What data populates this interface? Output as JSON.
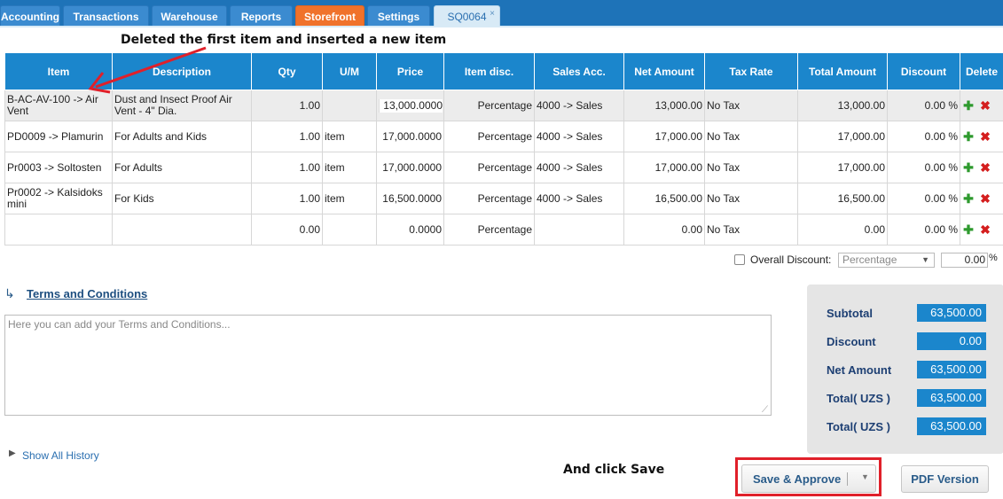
{
  "nav": {
    "tabs": [
      {
        "label": "Accounting"
      },
      {
        "label": "Transactions"
      },
      {
        "label": "Warehouse"
      },
      {
        "label": "Reports"
      },
      {
        "label": "Storefront"
      },
      {
        "label": "Settings"
      },
      {
        "label": "SQ0064"
      }
    ],
    "close_glyph": "×"
  },
  "annotations": {
    "top_note": "Deleted the first item and inserted a new item",
    "bottom_note": "And click Save",
    "colors": {
      "arrow": "#e0202a",
      "highlight_box": "#e0202a"
    }
  },
  "table": {
    "headers": [
      "Item",
      "Description",
      "Qty",
      "U/M",
      "Price",
      "Item disc.",
      "Sales Acc.",
      "Net Amount",
      "Tax Rate",
      "Total Amount",
      "Discount",
      "Delete"
    ],
    "rows": [
      {
        "item": "B-AC-AV-100 -> Air Vent",
        "description": "Dust and Insect Proof Air Vent - 4\" Dia.",
        "qty": "1.00",
        "um": "",
        "price": "13,000.0000",
        "item_disc": "Percentage",
        "sales_acc": "4000 -> Sales",
        "net_amount": "13,000.00",
        "tax_rate": "No Tax",
        "total_amount": "13,000.00",
        "discount": "0.00 %"
      },
      {
        "item": "PD0009 -> Plamurin",
        "description": "For Adults and Kids",
        "qty": "1.00",
        "um": "item",
        "price": "17,000.0000",
        "item_disc": "Percentage",
        "sales_acc": "4000 -> Sales",
        "net_amount": "17,000.00",
        "tax_rate": "No Tax",
        "total_amount": "17,000.00",
        "discount": "0.00 %"
      },
      {
        "item": "Pr0003 -> Soltosten",
        "description": "For Adults",
        "qty": "1.00",
        "um": "item",
        "price": "17,000.0000",
        "item_disc": "Percentage",
        "sales_acc": "4000 -> Sales",
        "net_amount": "17,000.00",
        "tax_rate": "No Tax",
        "total_amount": "17,000.00",
        "discount": "0.00 %"
      },
      {
        "item": "Pr0002 -> Kalsidoks mini",
        "description": "For Kids",
        "qty": "1.00",
        "um": "item",
        "price": "16,500.0000",
        "item_disc": "Percentage",
        "sales_acc": "4000 -> Sales",
        "net_amount": "16,500.00",
        "tax_rate": "No Tax",
        "total_amount": "16,500.00",
        "discount": "0.00 %"
      },
      {
        "item": "",
        "description": "",
        "qty": "0.00",
        "um": "",
        "price": "0.0000",
        "item_disc": "Percentage",
        "sales_acc": "",
        "net_amount": "0.00",
        "tax_rate": "No Tax",
        "total_amount": "0.00",
        "discount": "0.00 %"
      }
    ],
    "add_icon": "plus-icon",
    "delete_icon": "delete-x-icon",
    "add_color": "#2e9a2e",
    "delete_color": "#d41e1e"
  },
  "overall_discount": {
    "label": "Overall Discount:",
    "type_value": "Percentage",
    "value": "0.00",
    "unit": "%"
  },
  "terms": {
    "title": "Terms and Conditions",
    "placeholder": "Here you can add your Terms and Conditions..."
  },
  "history": {
    "link": "Show All History"
  },
  "totals": {
    "rows": [
      {
        "label": "Subtotal",
        "value": "63,500.00"
      },
      {
        "label": "Discount",
        "value": "0.00"
      },
      {
        "label": "Net Amount",
        "value": "63,500.00"
      },
      {
        "label": "Total( UZS )",
        "value": "63,500.00"
      },
      {
        "label": "Total( UZS )",
        "value": "63,500.00"
      }
    ]
  },
  "buttons": {
    "save_approve": "Save & Approve",
    "pdf": "PDF Version"
  },
  "theme": {
    "header_blue": "#1b86cc",
    "nav_blue": "#1e73b8",
    "storefront_orange": "#f0722b"
  }
}
